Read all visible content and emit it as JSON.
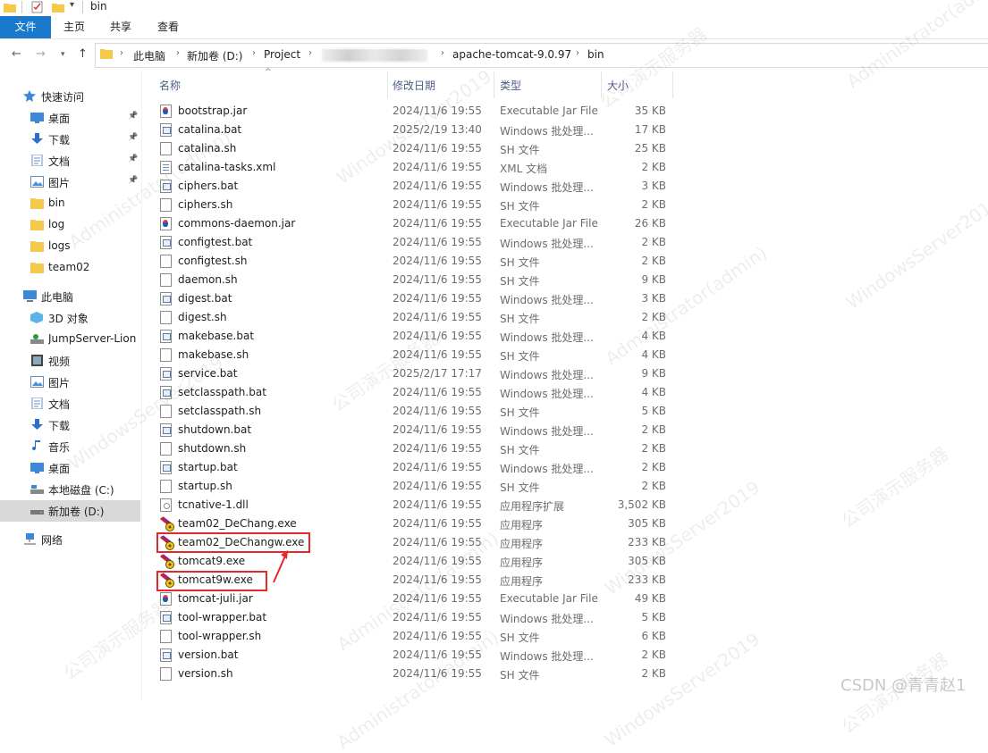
{
  "window": {
    "title": "bin"
  },
  "ribbon": {
    "tabs": [
      "文件",
      "主页",
      "共享",
      "查看"
    ]
  },
  "address": {
    "crumbs": [
      "此电脑",
      "新加卷 (D:)",
      "Project",
      "apache-tomcat-9.0.97",
      "bin"
    ]
  },
  "sidebar": {
    "quick_access": "快速访问",
    "pinned": [
      {
        "label": "桌面",
        "icon": "desktop-icon"
      },
      {
        "label": "下载",
        "icon": "download-icon"
      },
      {
        "label": "文档",
        "icon": "document-icon"
      },
      {
        "label": "图片",
        "icon": "picture-icon"
      }
    ],
    "recent_folders": [
      "bin",
      "log",
      "logs",
      "team02"
    ],
    "this_pc": "此电脑",
    "pc_items": [
      {
        "label": "3D 对象",
        "icon": "3d-objects-icon"
      },
      {
        "label": "JumpServer-Lion .",
        "icon": "network-drive-icon"
      },
      {
        "label": "视频",
        "icon": "video-icon"
      },
      {
        "label": "图片",
        "icon": "picture-icon"
      },
      {
        "label": "文档",
        "icon": "document-icon"
      },
      {
        "label": "下载",
        "icon": "download-icon"
      },
      {
        "label": "音乐",
        "icon": "music-icon"
      },
      {
        "label": "桌面",
        "icon": "desktop-icon"
      },
      {
        "label": "本地磁盘 (C:)",
        "icon": "local-disk-icon"
      },
      {
        "label": "新加卷 (D:)",
        "icon": "drive-icon"
      }
    ],
    "network": "网络"
  },
  "columns": {
    "name": "名称",
    "date": "修改日期",
    "type": "类型",
    "size": "大小"
  },
  "files": [
    {
      "name": "bootstrap.jar",
      "date": "2024/11/6 19:55",
      "type": "Executable Jar File",
      "size": "35 KB",
      "icon": "jar"
    },
    {
      "name": "catalina.bat",
      "date": "2025/2/19 13:40",
      "type": "Windows 批处理...",
      "size": "17 KB",
      "icon": "bat"
    },
    {
      "name": "catalina.sh",
      "date": "2024/11/6 19:55",
      "type": "SH 文件",
      "size": "25 KB",
      "icon": "sh"
    },
    {
      "name": "catalina-tasks.xml",
      "date": "2024/11/6 19:55",
      "type": "XML 文档",
      "size": "2 KB",
      "icon": "xml"
    },
    {
      "name": "ciphers.bat",
      "date": "2024/11/6 19:55",
      "type": "Windows 批处理...",
      "size": "3 KB",
      "icon": "bat"
    },
    {
      "name": "ciphers.sh",
      "date": "2024/11/6 19:55",
      "type": "SH 文件",
      "size": "2 KB",
      "icon": "sh"
    },
    {
      "name": "commons-daemon.jar",
      "date": "2024/11/6 19:55",
      "type": "Executable Jar File",
      "size": "26 KB",
      "icon": "jar"
    },
    {
      "name": "configtest.bat",
      "date": "2024/11/6 19:55",
      "type": "Windows 批处理...",
      "size": "2 KB",
      "icon": "bat"
    },
    {
      "name": "configtest.sh",
      "date": "2024/11/6 19:55",
      "type": "SH 文件",
      "size": "2 KB",
      "icon": "sh"
    },
    {
      "name": "daemon.sh",
      "date": "2024/11/6 19:55",
      "type": "SH 文件",
      "size": "9 KB",
      "icon": "sh"
    },
    {
      "name": "digest.bat",
      "date": "2024/11/6 19:55",
      "type": "Windows 批处理...",
      "size": "3 KB",
      "icon": "bat"
    },
    {
      "name": "digest.sh",
      "date": "2024/11/6 19:55",
      "type": "SH 文件",
      "size": "2 KB",
      "icon": "sh"
    },
    {
      "name": "makebase.bat",
      "date": "2024/11/6 19:55",
      "type": "Windows 批处理...",
      "size": "4 KB",
      "icon": "bat"
    },
    {
      "name": "makebase.sh",
      "date": "2024/11/6 19:55",
      "type": "SH 文件",
      "size": "4 KB",
      "icon": "sh"
    },
    {
      "name": "service.bat",
      "date": "2025/2/17 17:17",
      "type": "Windows 批处理...",
      "size": "9 KB",
      "icon": "bat"
    },
    {
      "name": "setclasspath.bat",
      "date": "2024/11/6 19:55",
      "type": "Windows 批处理...",
      "size": "4 KB",
      "icon": "bat"
    },
    {
      "name": "setclasspath.sh",
      "date": "2024/11/6 19:55",
      "type": "SH 文件",
      "size": "5 KB",
      "icon": "sh"
    },
    {
      "name": "shutdown.bat",
      "date": "2024/11/6 19:55",
      "type": "Windows 批处理...",
      "size": "2 KB",
      "icon": "bat"
    },
    {
      "name": "shutdown.sh",
      "date": "2024/11/6 19:55",
      "type": "SH 文件",
      "size": "2 KB",
      "icon": "sh"
    },
    {
      "name": "startup.bat",
      "date": "2024/11/6 19:55",
      "type": "Windows 批处理...",
      "size": "2 KB",
      "icon": "bat"
    },
    {
      "name": "startup.sh",
      "date": "2024/11/6 19:55",
      "type": "SH 文件",
      "size": "2 KB",
      "icon": "sh"
    },
    {
      "name": "tcnative-1.dll",
      "date": "2024/11/6 19:55",
      "type": "应用程序扩展",
      "size": "3,502 KB",
      "icon": "dll"
    },
    {
      "name": "team02_DeChang.exe",
      "date": "2024/11/6 19:55",
      "type": "应用程序",
      "size": "305 KB",
      "icon": "exe"
    },
    {
      "name": "team02_DeChangw.exe",
      "date": "2024/11/6 19:55",
      "type": "应用程序",
      "size": "233 KB",
      "icon": "exe"
    },
    {
      "name": "tomcat9.exe",
      "date": "2024/11/6 19:55",
      "type": "应用程序",
      "size": "305 KB",
      "icon": "exe"
    },
    {
      "name": "tomcat9w.exe",
      "date": "2024/11/6 19:55",
      "type": "应用程序",
      "size": "233 KB",
      "icon": "exe"
    },
    {
      "name": "tomcat-juli.jar",
      "date": "2024/11/6 19:55",
      "type": "Executable Jar File",
      "size": "49 KB",
      "icon": "jar"
    },
    {
      "name": "tool-wrapper.bat",
      "date": "2024/11/6 19:55",
      "type": "Windows 批处理...",
      "size": "5 KB",
      "icon": "bat"
    },
    {
      "name": "tool-wrapper.sh",
      "date": "2024/11/6 19:55",
      "type": "SH 文件",
      "size": "6 KB",
      "icon": "sh"
    },
    {
      "name": "version.bat",
      "date": "2024/11/6 19:55",
      "type": "Windows 批处理...",
      "size": "2 KB",
      "icon": "bat"
    },
    {
      "name": "version.sh",
      "date": "2024/11/6 19:55",
      "type": "SH 文件",
      "size": "2 KB",
      "icon": "sh"
    }
  ],
  "annotations": {
    "highlighted_files": [
      "team02_DeChangw.exe",
      "tomcat9w.exe"
    ],
    "highlight_color": "#e8262b"
  },
  "watermarks": [
    "Administrator(admin)",
    "WindowsServer2019",
    "公司演示服务器"
  ],
  "credit": "CSDN @青青赵1",
  "colors": {
    "accent": "#1979ca",
    "selected_bg": "#d9d9d9",
    "header_text": "#4d6082"
  }
}
